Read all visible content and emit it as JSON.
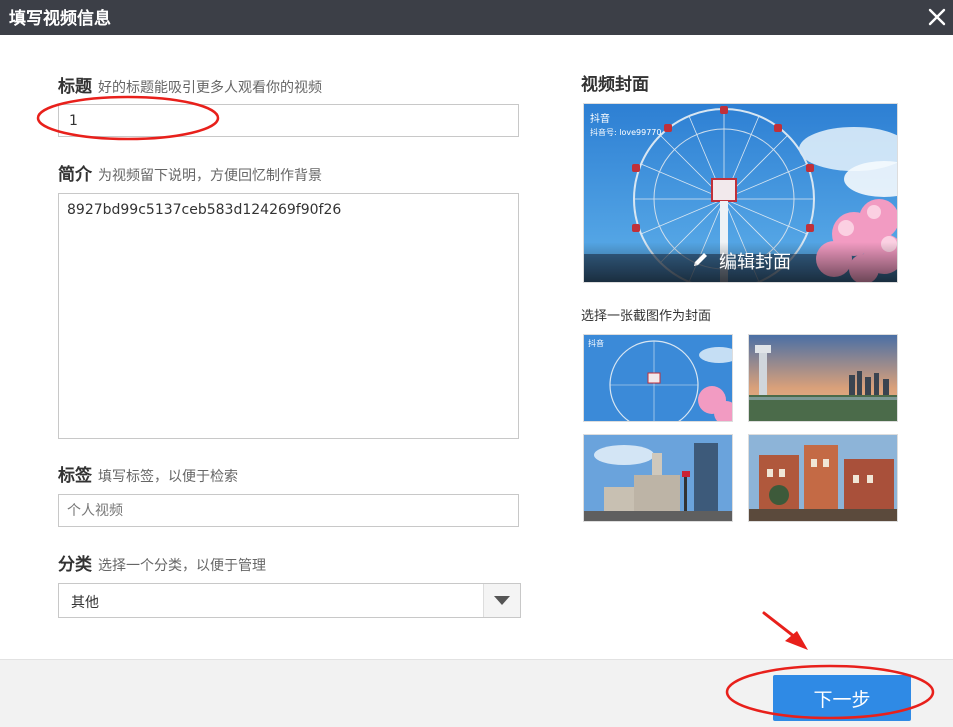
{
  "dialog": {
    "title": "填写视频信息",
    "close_icon": "close-icon"
  },
  "form": {
    "title_label": "标题",
    "title_hint": "好的标题能吸引更多人观看你的视频",
    "title_value": "1",
    "desc_label": "简介",
    "desc_hint": "为视频留下说明，方便回忆制作背景",
    "desc_value": "8927bd99c5137ceb583d124269f90f26",
    "tags_label": "标签",
    "tags_hint": "填写标签，以便于检索",
    "tags_placeholder": "个人视频",
    "category_label": "分类",
    "category_hint": "选择一个分类，以便于管理",
    "category_value": "其他"
  },
  "cover": {
    "heading": "视频封面",
    "brand": "抖音",
    "brand_id": "抖音号: love99770",
    "edit_label": "编辑封面",
    "pick_label": "选择一张截图作为封面",
    "thumbnails": [
      {
        "brand": "抖音"
      },
      {
        "caption": "",
        "corner": ""
      },
      {
        "corner": ""
      },
      {
        "corner": ""
      }
    ]
  },
  "footer": {
    "next_label": "下一步",
    "accent_color": "#2f8ae5"
  },
  "annotations": {
    "color": "#e8201b"
  }
}
